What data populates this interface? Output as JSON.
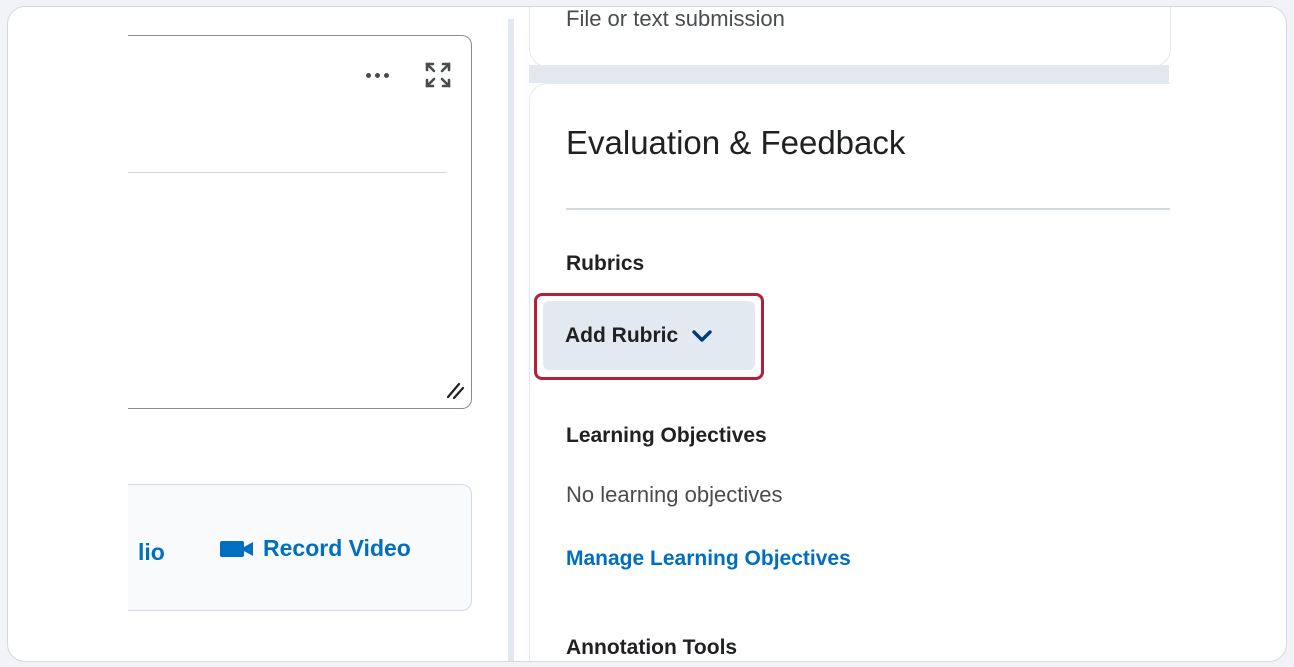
{
  "colors": {
    "link": "#006fbf",
    "focus_ring": "#b61f3a",
    "button_bg": "#e3e9f1",
    "text": "#202122"
  },
  "left_panel": {
    "editor": {
      "more_icon": "more-options-icon",
      "fullscreen_icon": "expand-icon",
      "resize_icon": "resize-handle-icon"
    },
    "recording": {
      "audio_label": "lio",
      "video_label": "Record Video",
      "video_icon": "video-camera-icon"
    }
  },
  "right_panel": {
    "previous_card_text": "File or text submission",
    "section_title": "Evaluation & Feedback",
    "rubrics": {
      "label": "Rubrics",
      "add_button_label": "Add Rubric",
      "add_button_icon": "chevron-down-icon"
    },
    "learning_objectives": {
      "label": "Learning Objectives",
      "empty_text": "No learning objectives",
      "manage_link": "Manage Learning Objectives"
    },
    "annotation_tools": {
      "label": "Annotation Tools"
    }
  }
}
